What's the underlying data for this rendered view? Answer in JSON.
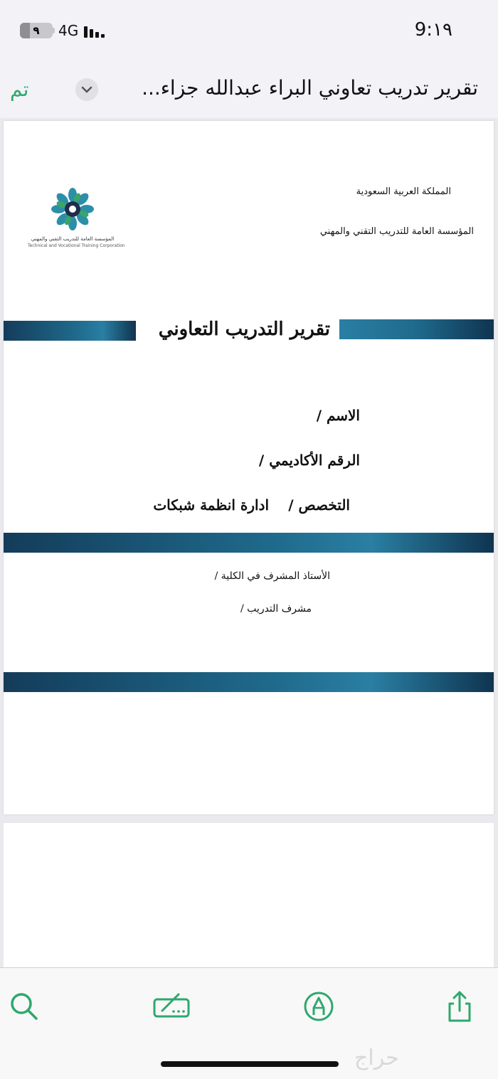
{
  "status_bar": {
    "battery_level": "٩",
    "network": "4G",
    "time": "9:١٩"
  },
  "nav": {
    "done_label": "تم",
    "document_title": "تقرير تدريب تعاوني  البراء عبدالله جزاء..."
  },
  "document": {
    "header_line1": "المملكة العربية السعودية",
    "header_line2": "المؤسسة العامة للتدريب التقني والمهني",
    "logo_caption_ar": "المؤسسة العامة للتدريب التقني والمهني",
    "logo_caption_en": "Technical and Vocational Training Corporation",
    "report_title": "تقرير التدريب التعاوني",
    "name_label": "الاسم /",
    "academic_number_label": "الرقم الأكاديمي /",
    "specialization_label": "التخصص /",
    "specialization_value": "ادارة انظمة شبكات",
    "college_supervisor_label": "الأستاذ المشرف في الكلية  /",
    "training_supervisor_label": "مشرف التدريب /"
  },
  "toolbar": {
    "icons": [
      "search-icon",
      "markup-icon",
      "pen-icon",
      "share-icon"
    ]
  },
  "watermark": "حراج",
  "colors": {
    "accent": "#2ea86d",
    "band_dark": "#0f3450",
    "band_light": "#2a7fa3"
  }
}
